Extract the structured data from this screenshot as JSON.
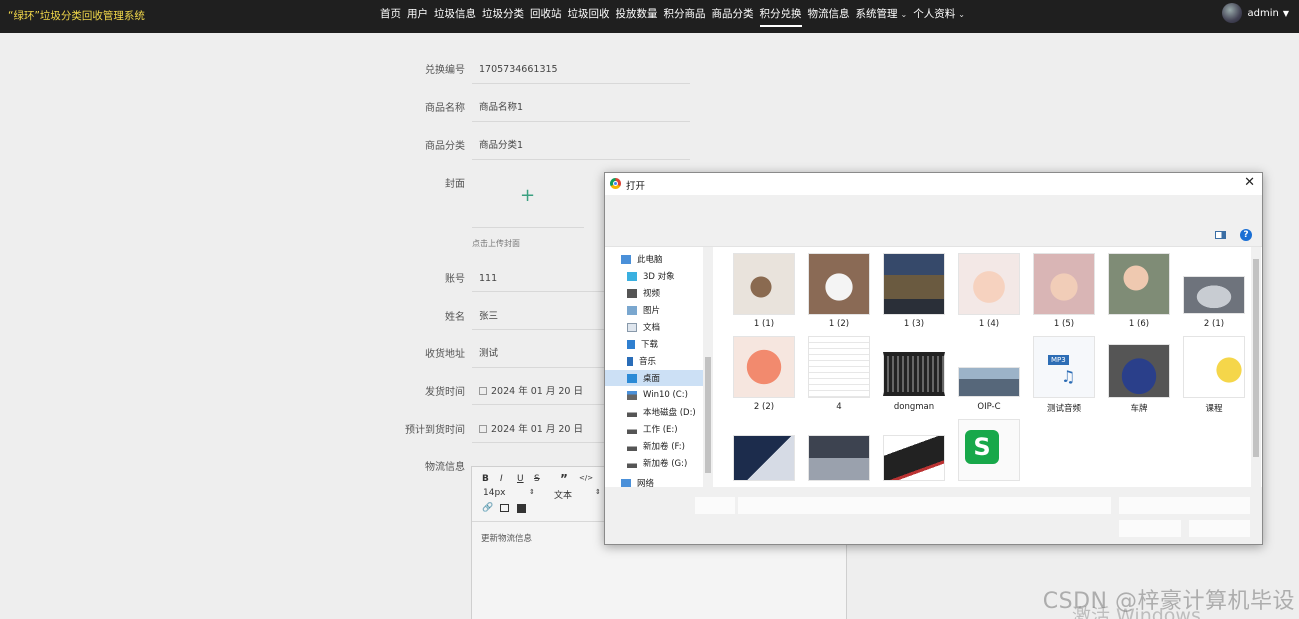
{
  "app": {
    "title": "“绿环”垃圾分类回收管理系统"
  },
  "nav": {
    "items": [
      "首页",
      "用户",
      "垃圾信息",
      "垃圾分类",
      "回收站",
      "垃圾回收",
      "投放数量",
      "积分商品",
      "商品分类",
      "积分兑换",
      "物流信息",
      "系统管理",
      "个人资料"
    ],
    "active": "积分兑换"
  },
  "user": {
    "name": "admin"
  },
  "form": {
    "exchange_no": {
      "label": "兑换编号",
      "value": "1705734661315"
    },
    "product_name": {
      "label": "商品名称",
      "value": "商品名称1"
    },
    "product_category": {
      "label": "商品分类",
      "value": "商品分类1"
    },
    "cover": {
      "label": "封面",
      "hint": "点击上传封面"
    },
    "account": {
      "label": "账号",
      "value": "111"
    },
    "name": {
      "label": "姓名",
      "value": "张三"
    },
    "address": {
      "label": "收货地址",
      "value": "测试"
    },
    "ship_time": {
      "label": "发货时间",
      "value": "2024 年 01 月 20 日"
    },
    "arrival_time": {
      "label": "预计到货时间",
      "value": "2024 年 01 月 20 日"
    },
    "logistics": {
      "label": "物流信息",
      "content": "更新物流信息"
    }
  },
  "editor": {
    "bold": "B",
    "italic": "I",
    "underline": "U",
    "strike": "S",
    "quote": "”",
    "code": "</>",
    "font_size": "14px",
    "block_type": "文本"
  },
  "dialog": {
    "title": "打开",
    "nav_tree": [
      {
        "label": "此电脑",
        "icon": "computer-icon"
      },
      {
        "label": "3D 对象",
        "icon": "3d-objects-icon"
      },
      {
        "label": "视频",
        "icon": "video-folder-icon"
      },
      {
        "label": "图片",
        "icon": "pictures-folder-icon"
      },
      {
        "label": "文档",
        "icon": "documents-folder-icon"
      },
      {
        "label": "下载",
        "icon": "downloads-folder-icon"
      },
      {
        "label": "音乐",
        "icon": "music-folder-icon"
      },
      {
        "label": "桌面",
        "icon": "desktop-folder-icon"
      },
      {
        "label": "Win10 (C:)",
        "icon": "drive-icon"
      },
      {
        "label": "本地磁盘 (D:)",
        "icon": "drive-icon"
      },
      {
        "label": "工作 (E:)",
        "icon": "drive-icon"
      },
      {
        "label": "新加卷 (F:)",
        "icon": "drive-icon"
      },
      {
        "label": "新加卷 (G:)",
        "icon": "drive-icon"
      },
      {
        "label": "网络",
        "icon": "network-icon"
      }
    ],
    "files": [
      {
        "name": "1 (1)"
      },
      {
        "name": "1 (2)"
      },
      {
        "name": "1 (3)"
      },
      {
        "name": "1 (4)"
      },
      {
        "name": "1 (5)"
      },
      {
        "name": "1 (6)"
      },
      {
        "name": "2 (1)"
      },
      {
        "name": "2 (2)"
      },
      {
        "name": "4"
      },
      {
        "name": "dongman"
      },
      {
        "name": "OIP-C"
      },
      {
        "name": "测试音频"
      },
      {
        "name": "车牌"
      },
      {
        "name": "课程"
      },
      {
        "name": ""
      },
      {
        "name": ""
      },
      {
        "name": ""
      },
      {
        "name": ""
      }
    ],
    "mp3_badge": "MP3"
  },
  "watermark": "CSDN @梓豪计算机毕设",
  "activate": "激活 Windows"
}
